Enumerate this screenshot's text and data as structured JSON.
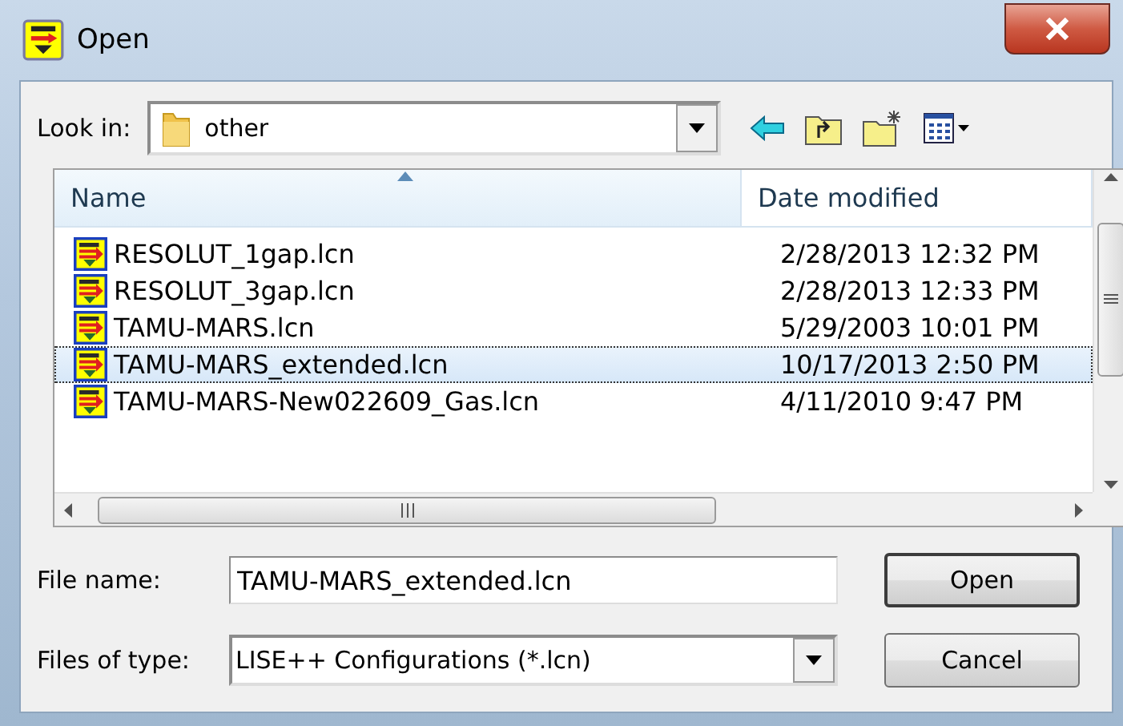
{
  "window": {
    "title": "Open"
  },
  "look_in": {
    "label": "Look in:",
    "value": "other"
  },
  "list": {
    "columns": [
      {
        "label": "Name",
        "sorted": true
      },
      {
        "label": "Date modified",
        "sorted": false
      }
    ],
    "rows": [
      {
        "name": "RESOLUT_1gap.lcn",
        "date": "2/28/2013 12:32 PM",
        "selected": false
      },
      {
        "name": "RESOLUT_3gap.lcn",
        "date": "2/28/2013 12:33 PM",
        "selected": false
      },
      {
        "name": "TAMU-MARS.lcn",
        "date": "5/29/2003 10:01 PM",
        "selected": false
      },
      {
        "name": "TAMU-MARS_extended.lcn",
        "date": "10/17/2013 2:50 PM",
        "selected": true
      },
      {
        "name": "TAMU-MARS-New022609_Gas.lcn",
        "date": "4/11/2010 9:47 PM",
        "selected": false
      }
    ]
  },
  "file_name": {
    "label": "File name:",
    "value": "TAMU-MARS_extended.lcn"
  },
  "file_type": {
    "label": "Files of type:",
    "value": "LISE++ Configurations (*.lcn)"
  },
  "buttons": [
    {
      "label": "Open",
      "default": true
    },
    {
      "label": "Cancel",
      "default": false
    }
  ]
}
